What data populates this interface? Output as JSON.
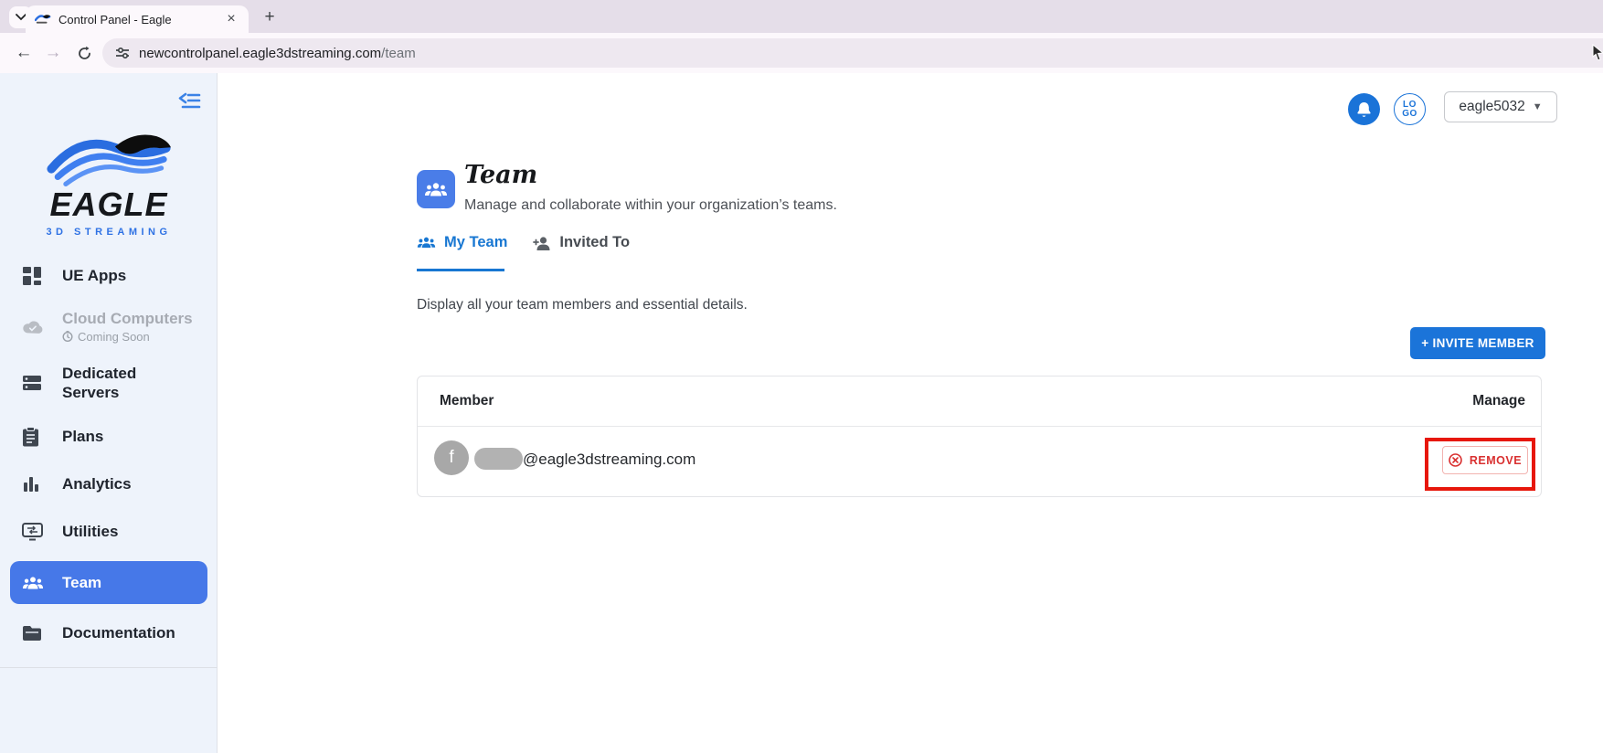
{
  "browser": {
    "tab_title": "Control Panel - Eagle",
    "close_glyph": "×",
    "newtab_glyph": "+",
    "back_glyph": "←",
    "forward_glyph": "→",
    "url_host": "newcontrolpanel.eagle3dstreaming.com",
    "url_path": "/team"
  },
  "header": {
    "logo_avatar_line1": "LO",
    "logo_avatar_line2": "GO",
    "account_name": "eagle5032",
    "caret_glyph": "▼"
  },
  "sidebar": {
    "brand_name": "EAGLE",
    "brand_tagline": "3D STREAMING",
    "items": [
      {
        "label": "UE Apps"
      },
      {
        "label": "Cloud Computers",
        "sublabel": "Coming Soon"
      },
      {
        "label": "Dedicated Servers"
      },
      {
        "label": "Plans"
      },
      {
        "label": "Analytics"
      },
      {
        "label": "Utilities"
      },
      {
        "label": "Team"
      },
      {
        "label": "Documentation"
      }
    ]
  },
  "main": {
    "page_title": "Team",
    "page_subtitle": "Manage and collaborate within your organization’s teams.",
    "tabs": [
      {
        "label": "My Team"
      },
      {
        "label": "Invited To"
      }
    ],
    "description": "Display all your team members and essential details.",
    "invite_button_label": "+ INVITE MEMBER",
    "table": {
      "columns": [
        "Member",
        "Manage"
      ],
      "rows": [
        {
          "avatar_initial": "f",
          "email_visible": "@eagle3dstreaming.com",
          "action_label": "REMOVE"
        }
      ]
    }
  },
  "colors": {
    "accent_blue": "#1b74d9",
    "selected_blue": "#4678e8",
    "sidebar_bg": "#eef3fb",
    "chrome_strip": "#e5dee9",
    "remove_red": "#d93030",
    "annotation_red": "#e7170b"
  }
}
